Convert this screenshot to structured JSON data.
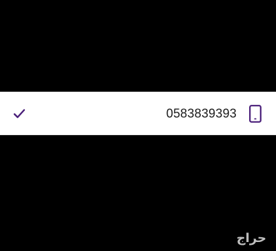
{
  "contact": {
    "phone_number": "0583839393",
    "selected": true,
    "icon_check": "check-icon",
    "icon_phone": "mobile-phone-icon"
  },
  "watermark": {
    "text": "حراج"
  },
  "colors": {
    "background": "#000000",
    "row_background": "#ffffff",
    "accent_purple": "#4a1f7a",
    "text": "#1b1b1b"
  }
}
